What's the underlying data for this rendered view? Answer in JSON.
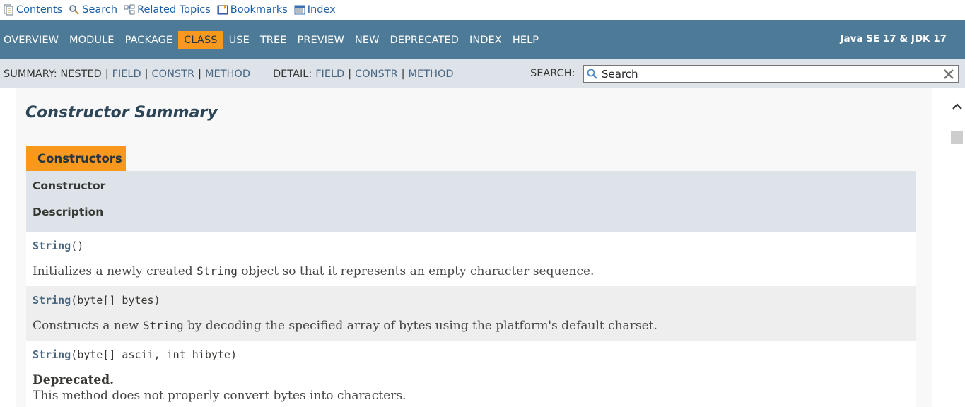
{
  "helpbar": {
    "items": [
      {
        "label": "Contents",
        "icon": "contents-icon"
      },
      {
        "label": "Search",
        "icon": "search-icon"
      },
      {
        "label": "Related Topics",
        "icon": "related-topics-icon"
      },
      {
        "label": "Bookmarks",
        "icon": "bookmarks-icon"
      },
      {
        "label": "Index",
        "icon": "index-icon"
      }
    ]
  },
  "topnav": {
    "items": [
      "OVERVIEW",
      "MODULE",
      "PACKAGE",
      "CLASS",
      "USE",
      "TREE",
      "PREVIEW",
      "NEW",
      "DEPRECATED",
      "INDEX",
      "HELP"
    ],
    "active": "CLASS",
    "product": "Java SE 17 & JDK 17"
  },
  "subnav": {
    "summary_label": "SUMMARY: NESTED",
    "summary_links": [
      "FIELD",
      "CONSTR",
      "METHOD"
    ],
    "detail_label": "DETAIL:",
    "detail_links": [
      "FIELD",
      "CONSTR",
      "METHOD"
    ],
    "search_label": "SEARCH:",
    "search_placeholder": "Search"
  },
  "content": {
    "section_title": "Constructor Summary",
    "caption": "Constructors",
    "headers": [
      "Constructor",
      "Description"
    ],
    "rows": [
      {
        "name": "String",
        "params": "()",
        "desc_before": "Initializes a newly created ",
        "desc_code": "String",
        "desc_after": " object so that it represents an empty character sequence."
      },
      {
        "name": "String",
        "params": "(byte[] bytes)",
        "desc_before": "Constructs a new ",
        "desc_code": "String",
        "desc_after": " by decoding the specified array of bytes using the platform's default charset."
      },
      {
        "name": "String",
        "params": "(byte[] ascii, int hibyte)",
        "deprecated_label": "Deprecated.",
        "deprecated_text": "This method does not properly convert bytes into characters."
      }
    ]
  },
  "colors": {
    "nav_bg": "#4d7a97",
    "active_tab": "#f8981d",
    "subnav_bg": "#dee3e9",
    "link": "#4a6782"
  }
}
